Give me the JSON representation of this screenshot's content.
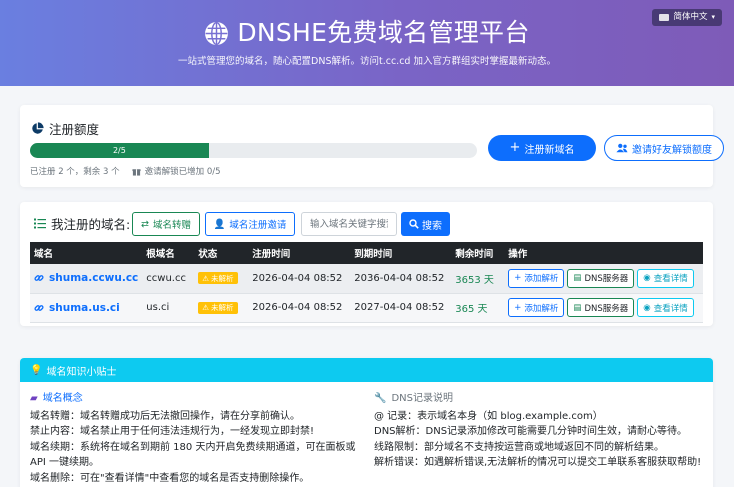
{
  "header": {
    "title": "DNSHE免费域名管理平台",
    "subtitle": "一站式管理您的域名，随心配置DNS解析。访问t.cc.cd 加入官方群组实时掌握最新动态。",
    "language": "简体中文"
  },
  "quota": {
    "title": "注册额度",
    "progress_text": "2/5",
    "progress_fraction": 0.4,
    "used_text": "已注册 2 个，剩余 3 个",
    "invite_text": "邀请解锁已增加 0/5",
    "register_button": "注册新域名",
    "invite_button": "邀请好友解锁额度"
  },
  "domains": {
    "title": "我注册的域名:",
    "transfer_button": "域名转赠",
    "invite_button": "域名注册邀请",
    "search_placeholder": "输入域名关键字搜索",
    "search_button": "搜索",
    "columns": [
      "域名",
      "根域名",
      "状态",
      "注册时间",
      "到期时间",
      "剩余时间",
      "操作"
    ],
    "rows": [
      {
        "name": "shuma.ccwu.cc",
        "root": "ccwu.cc",
        "status": "未解析",
        "registered": "2026-04-04 08:52",
        "expires": "2036-04-04 08:52",
        "remaining": "3653 天"
      },
      {
        "name": "shuma.us.ci",
        "root": "us.ci",
        "status": "未解析",
        "registered": "2026-04-04 08:52",
        "expires": "2027-04-04 08:52",
        "remaining": "365 天"
      }
    ],
    "actions": {
      "add": "添加解析",
      "dns": "DNS服务器",
      "details": "查看详情"
    }
  },
  "tips": {
    "title": "域名知识小贴士",
    "left_title": "域名概念",
    "left_lines": [
      "域名转赠：域名转赠成功后无法撤回操作，请在分享前确认。",
      "禁止内容：域名禁止用于任何违法违规行为，一经发现立即封禁!",
      "域名续期：系统将在域名到期前 180 天内开启免费续期通道，可在面板或",
      "API 一键续期。",
      "域名删除：可在\"查看详情\"中查看您的域名是否支持删除操作。"
    ],
    "right_title": "DNS记录说明",
    "right_lines": [
      "@ 记录：表示域名本身（如 blog.example.com）",
      "DNS解析：DNS记录添加修改可能需要几分钟时间生效，请耐心等待。",
      "线路限制：部分域名不支持按运营商或地域返回不同的解析结果。",
      "解析错误：如遇解析错误,无法解析的情况可以提交工单联系客服获取帮助!"
    ]
  },
  "colors": {
    "primary": "#0d6efd",
    "success": "#198754",
    "warning": "#ffc107",
    "info": "#0dcaf0",
    "dark": "#212529"
  }
}
